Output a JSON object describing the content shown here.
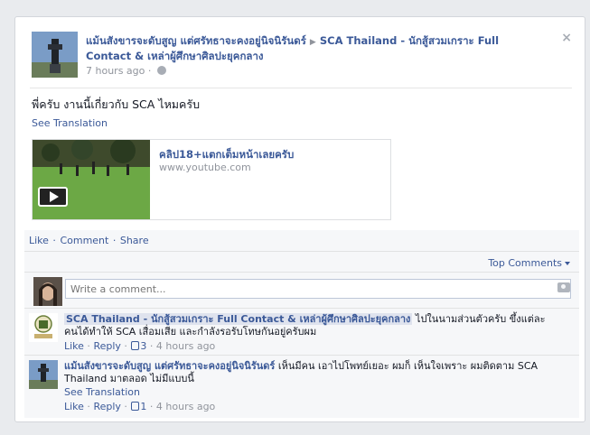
{
  "post": {
    "author": "แม้นสังขารจะดับสูญ แต่ศรัทธาจะคงอยู่นิจนิรันดร์",
    "target": "SCA Thailand - นักสู้สวมเกราะ Full Contact & เหล่าผู้ศึกษาศิลปะยุคกลาง",
    "time": "7 hours ago",
    "text": "พี่ครับ งานนี้เกี่ยวกับ SCA ไหมครับ",
    "see_translation": "See Translation",
    "close": "×"
  },
  "share": {
    "title": "คลิป18+แตกเต็มหน้าเลยครับ",
    "url": "www.youtube.com"
  },
  "actions": {
    "like": "Like",
    "comment": "Comment",
    "share": "Share"
  },
  "top_comments": "Top Comments",
  "comment_input": {
    "placeholder": "Write a comment..."
  },
  "comments": [
    {
      "name": "SCA Thailand - นักสู้สวมเกราะ Full Contact & เหล่าผู้ศึกษาศิลปะยุคกลาง",
      "text": "ไปในนามส่วนตัวครับ ขึ้งแต่ละคนได้ทำให้ SCA เสื่อมเสีย และกำลังรอรับโทษกันอยู่ครับผม",
      "like": "Like",
      "reply": "Reply",
      "likes": "3",
      "time": "4 hours ago"
    },
    {
      "name": "แม้นสังขารจะดับสูญ แต่ศรัทธาจะคงอยู่นิจนิรันดร์",
      "text": "เห็นมีคน เอาไปโพทย์เยอะ ผมก็ เห็นใจเพราะ ผมติดตาม SCA Thailand มาตลอด ไม่มีแบบนี้",
      "see_translation": "See Translation",
      "like": "Like",
      "reply": "Reply",
      "likes": "1",
      "time": "4 hours ago"
    }
  ]
}
